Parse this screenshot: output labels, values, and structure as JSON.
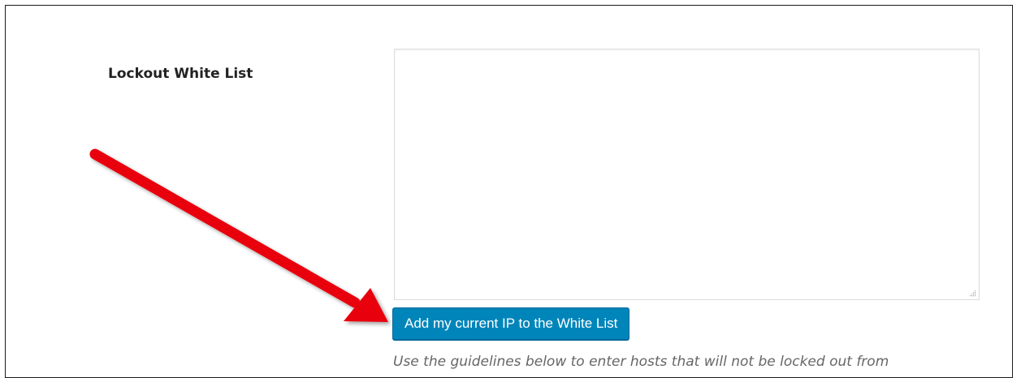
{
  "settings": {
    "label": "Lockout White List",
    "textarea_value": "",
    "button_label": "Add my current IP to the White List",
    "description": "Use the guidelines below to enter hosts that will not be locked out from"
  },
  "colors": {
    "button": "#0085ba",
    "annotation_arrow": "#e8000b"
  },
  "annotation": {
    "icon": "red-arrow-icon"
  }
}
